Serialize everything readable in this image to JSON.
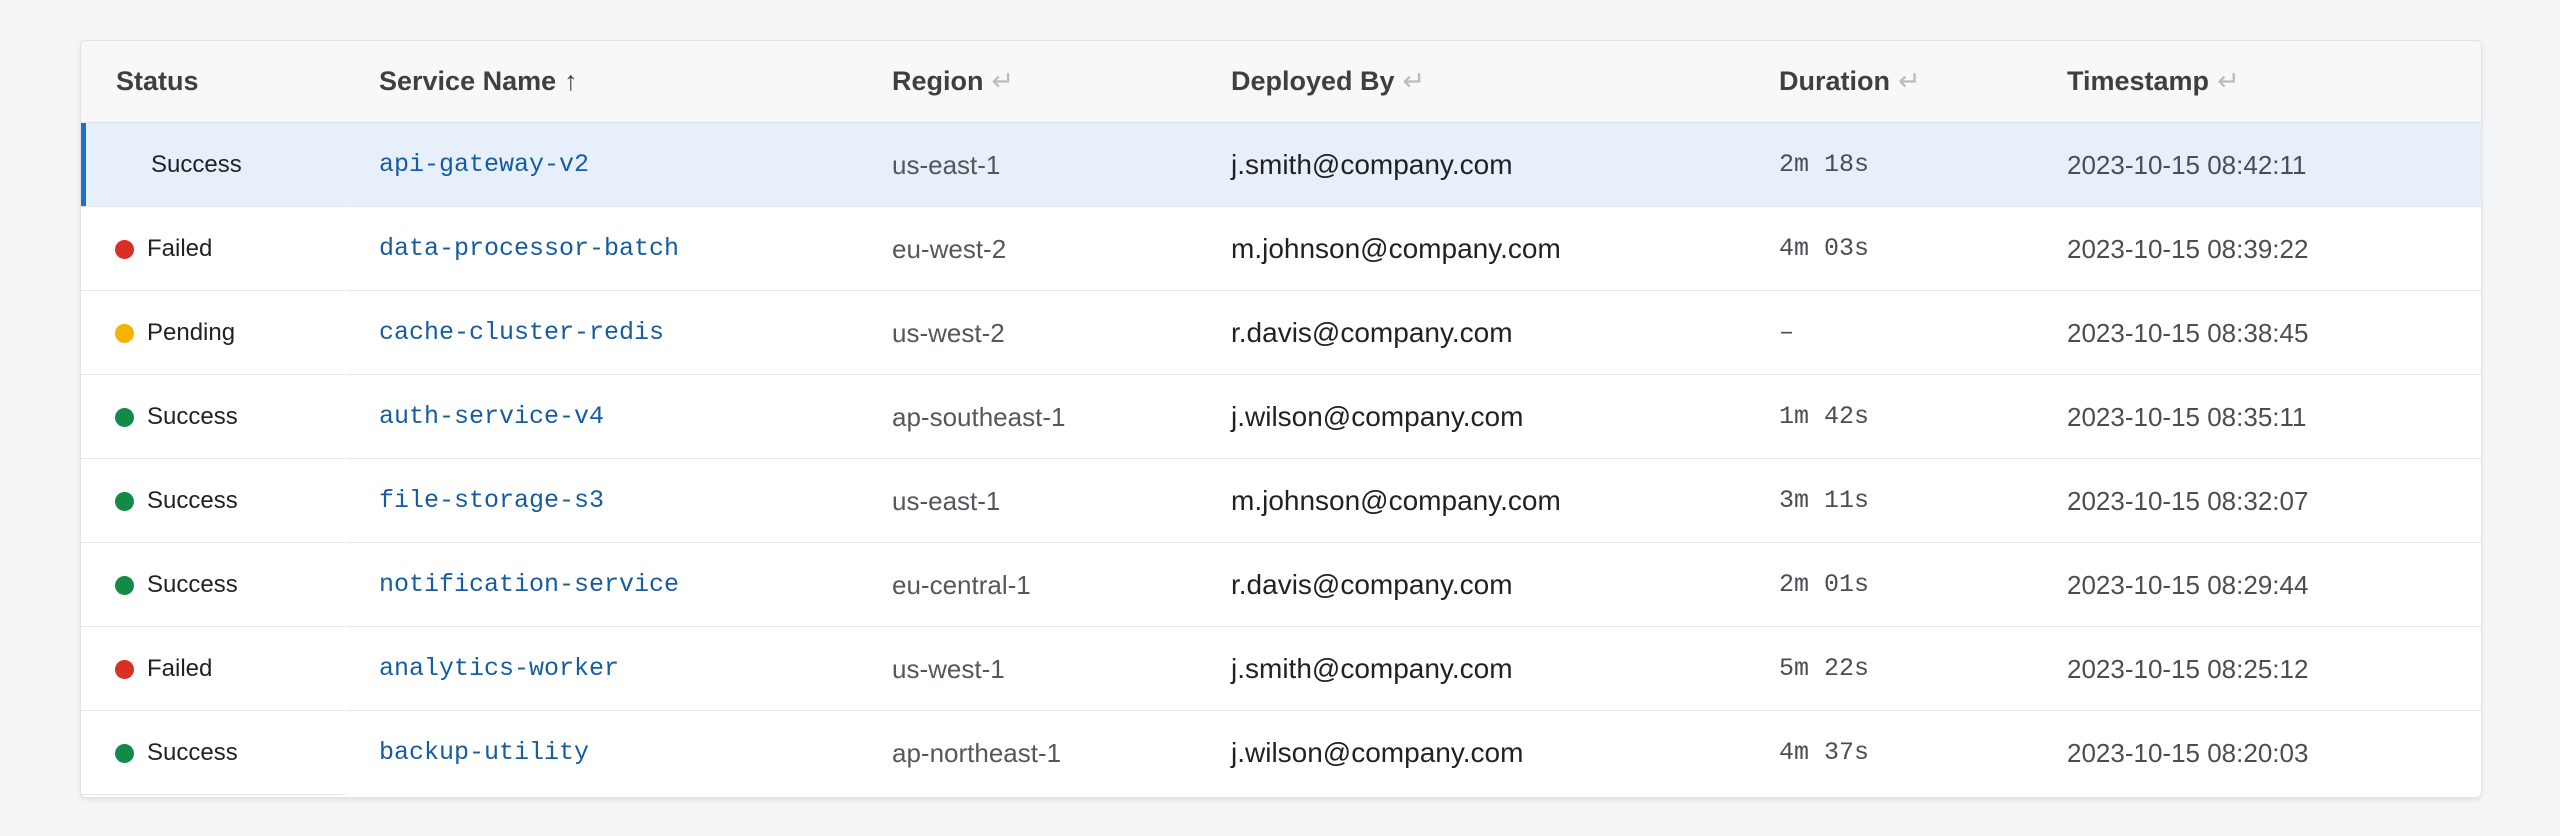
{
  "columns": {
    "status": "Status",
    "service": "Service Name",
    "service_sort_icon": "↑",
    "region": "Region",
    "deployed_by": "Deployed By",
    "duration": "Duration",
    "timestamp": "Timestamp",
    "sort_hint_icon": "↵"
  },
  "status_colors": {
    "Success": "#148a48",
    "Failed": "#d93025",
    "Pending": "#f6b200"
  },
  "selection_color": "#1f6fd1",
  "rows": [
    {
      "status": "Success",
      "service": "api-gateway-v2",
      "region": "us-east-1",
      "deployed_by": "j.smith@company.com",
      "duration": "2m 18s",
      "timestamp": "2023-10-15 08:42:11",
      "selected": true
    },
    {
      "status": "Failed",
      "service": "data-processor-batch",
      "region": "eu-west-2",
      "deployed_by": "m.johnson@company.com",
      "duration": "4m 03s",
      "timestamp": "2023-10-15 08:39:22",
      "selected": false
    },
    {
      "status": "Pending",
      "service": "cache-cluster-redis",
      "region": "us-west-2",
      "deployed_by": "r.davis@company.com",
      "duration": "–",
      "timestamp": "2023-10-15 08:38:45",
      "selected": false
    },
    {
      "status": "Success",
      "service": "auth-service-v4",
      "region": "ap-southeast-1",
      "deployed_by": "j.wilson@company.com",
      "duration": "1m 42s",
      "timestamp": "2023-10-15 08:35:11",
      "selected": false
    },
    {
      "status": "Success",
      "service": "file-storage-s3",
      "region": "us-east-1",
      "deployed_by": "m.johnson@company.com",
      "duration": "3m 11s",
      "timestamp": "2023-10-15 08:32:07",
      "selected": false
    },
    {
      "status": "Success",
      "service": "notification-service",
      "region": "eu-central-1",
      "deployed_by": "r.davis@company.com",
      "duration": "2m 01s",
      "timestamp": "2023-10-15 08:29:44",
      "selected": false
    },
    {
      "status": "Failed",
      "service": "analytics-worker",
      "region": "us-west-1",
      "deployed_by": "j.smith@company.com",
      "duration": "5m 22s",
      "timestamp": "2023-10-15 08:25:12",
      "selected": false
    },
    {
      "status": "Success",
      "service": "backup-utility",
      "region": "ap-northeast-1",
      "deployed_by": "j.wilson@company.com",
      "duration": "4m 37s",
      "timestamp": "2023-10-15 08:20:03",
      "selected": false
    }
  ]
}
